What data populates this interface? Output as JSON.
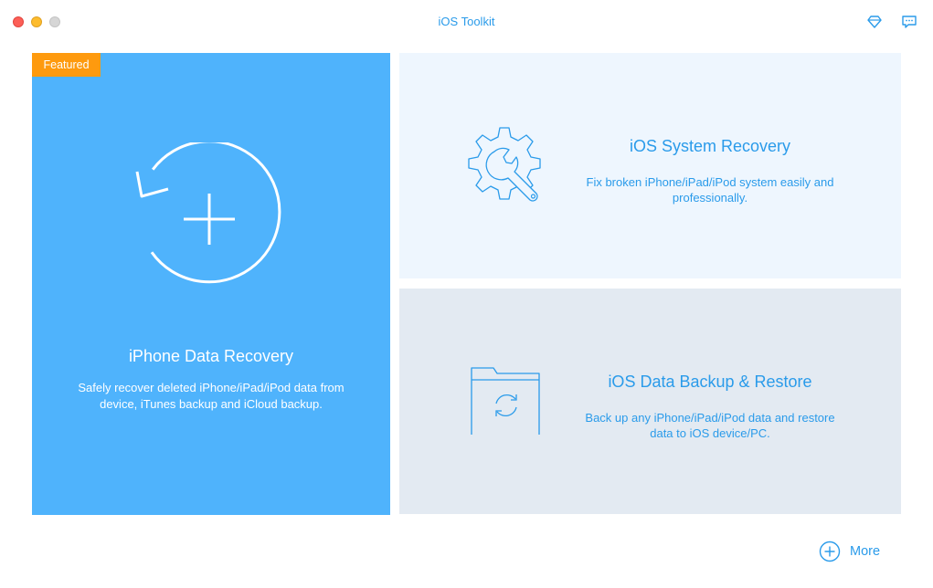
{
  "window": {
    "title": "iOS Toolkit"
  },
  "header": {
    "icons": [
      "diamond-icon",
      "feedback-icon"
    ]
  },
  "featured_card": {
    "badge": "Featured",
    "icon": "restore-plus-icon",
    "title": "iPhone Data Recovery",
    "description": "Safely recover deleted iPhone/iPad/iPod data from device, iTunes backup and iCloud backup."
  },
  "system_recovery_card": {
    "icon": "gear-wrench-icon",
    "title": "iOS System Recovery",
    "description": "Fix broken iPhone/iPad/iPod system easily and professionally."
  },
  "backup_card": {
    "icon": "folder-sync-icon",
    "title": "iOS Data Backup & Restore",
    "description": "Back up any iPhone/iPad/iPod data and restore data to iOS device/PC."
  },
  "footer": {
    "more_label": "More",
    "more_icon": "plus-circle-icon"
  },
  "colors": {
    "accent": "#2a9bea",
    "featured_bg": "#4fb3fc",
    "badge_bg": "#fe9a0e",
    "card_light": "#eef6fe",
    "card_gray": "#e3eaf2"
  }
}
